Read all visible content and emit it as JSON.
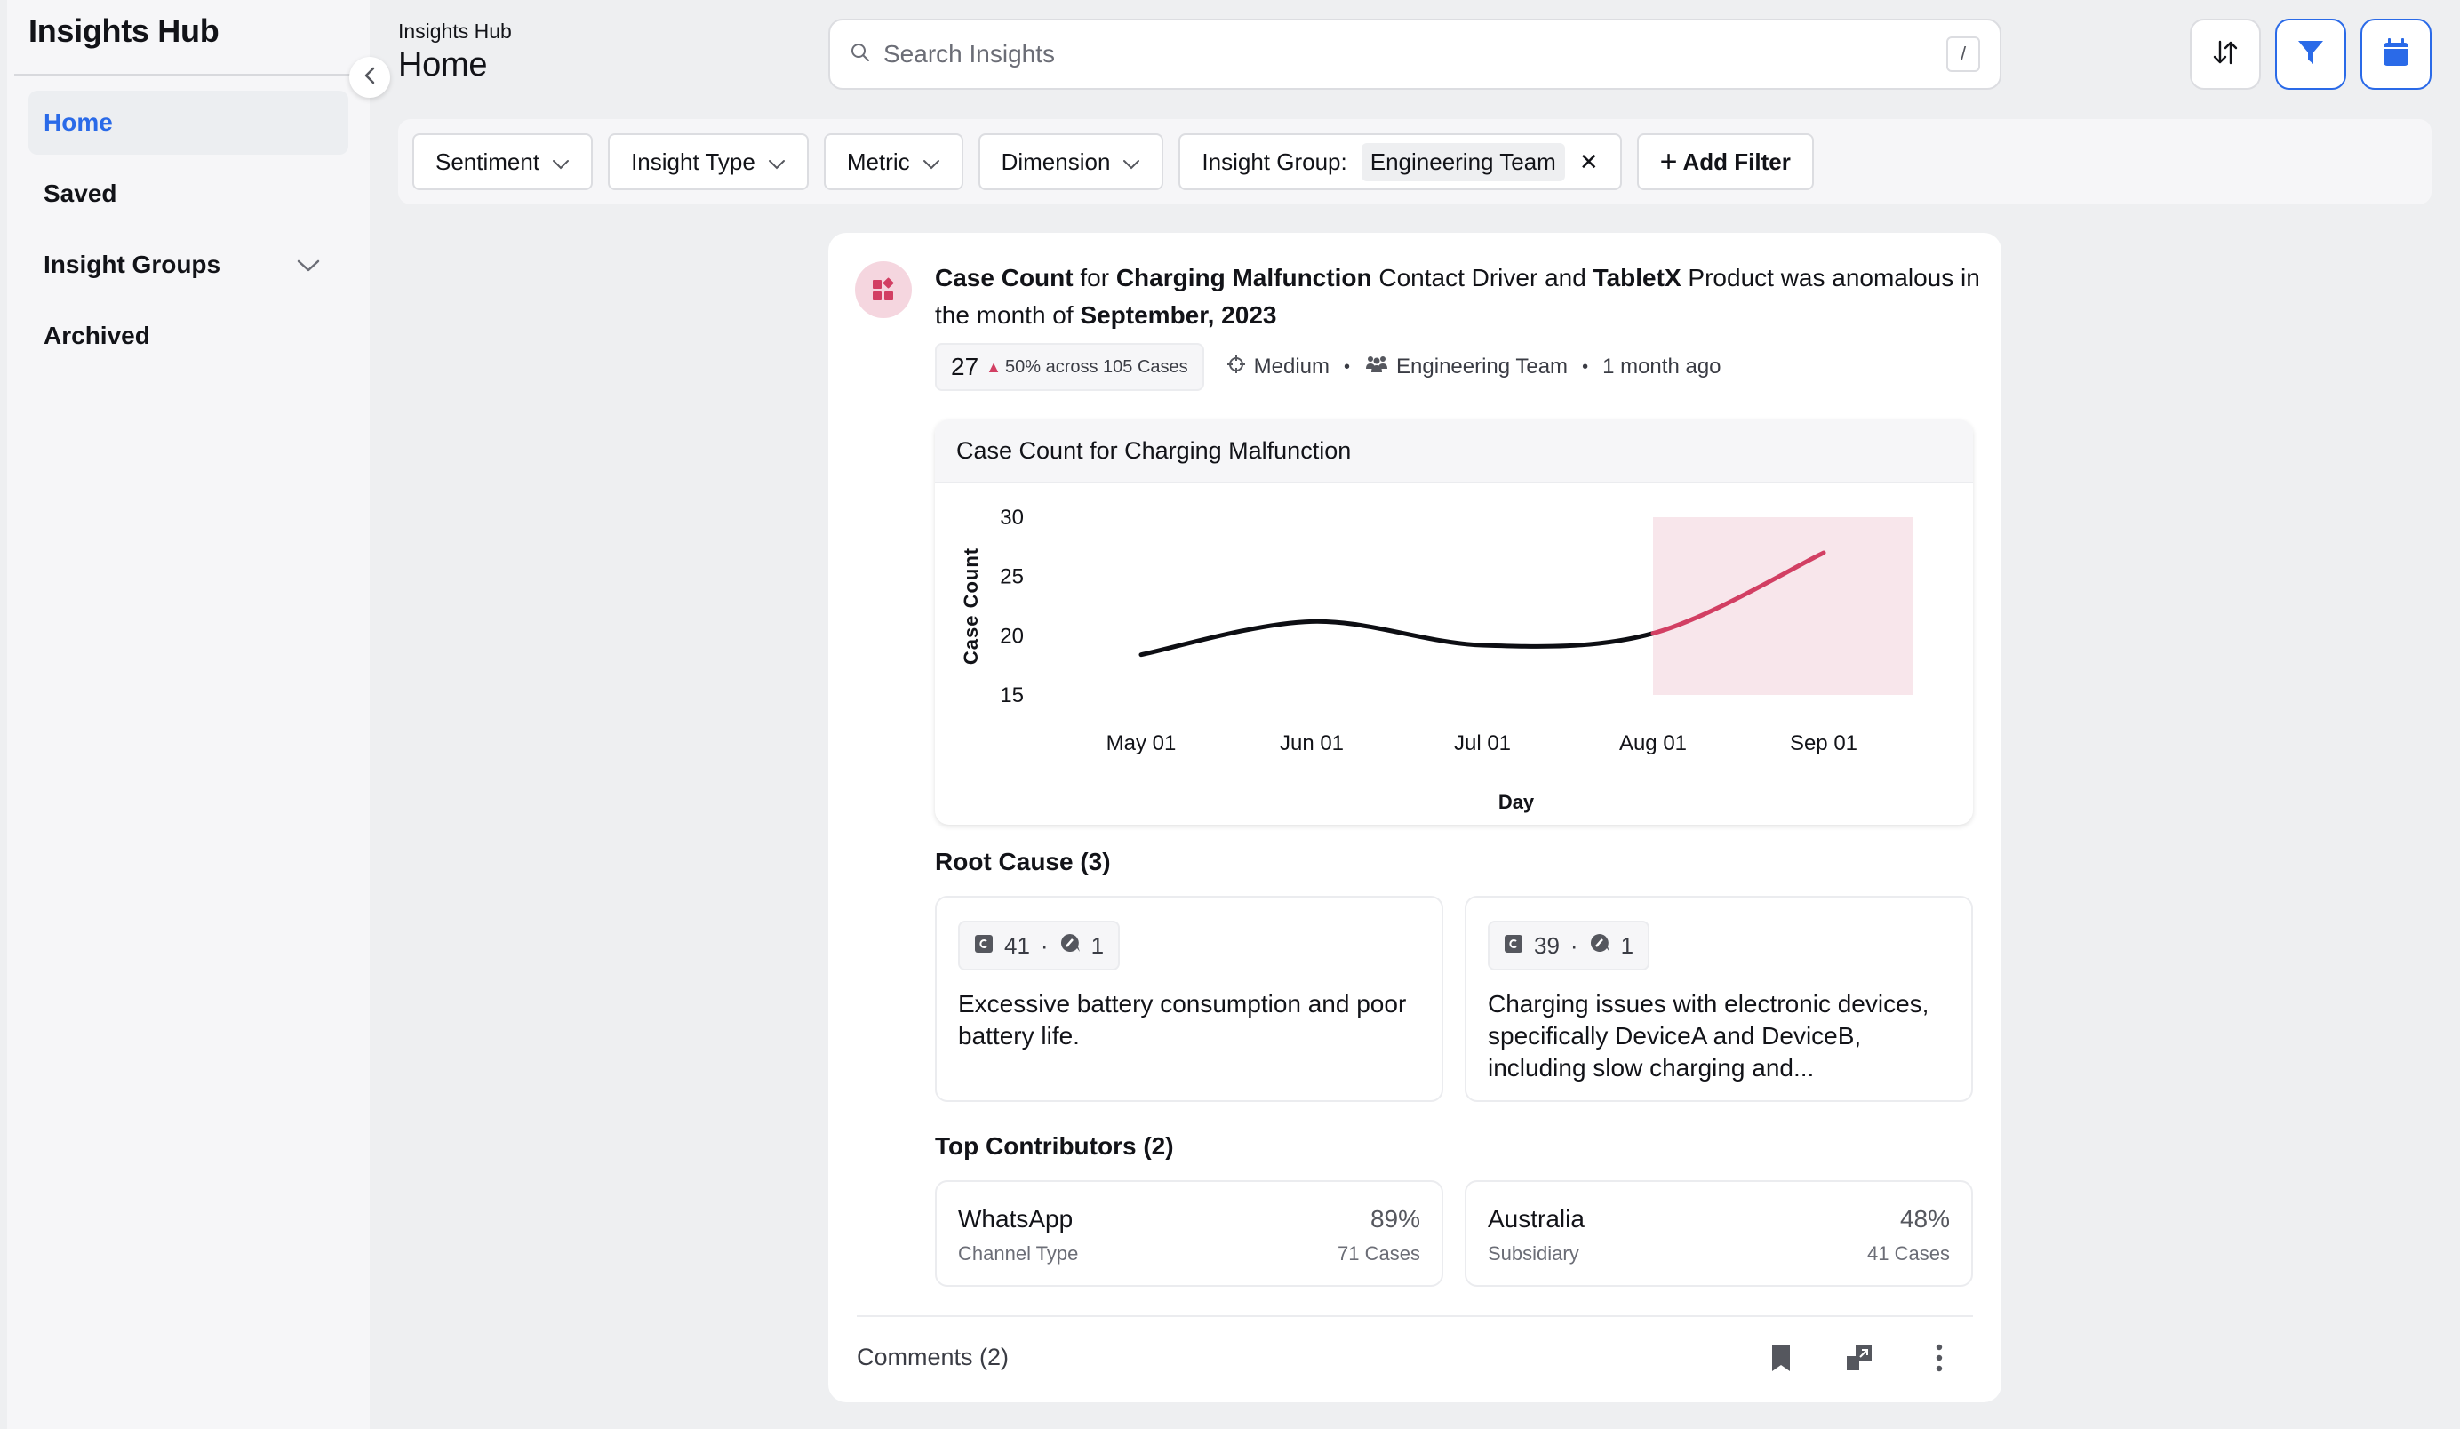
{
  "sidebar": {
    "brand": "Insights Hub",
    "items": [
      {
        "label": "Home",
        "active": true
      },
      {
        "label": "Saved"
      },
      {
        "label": "Insight Groups",
        "expandable": true
      },
      {
        "label": "Archived"
      }
    ]
  },
  "header": {
    "breadcrumb": "Insights Hub",
    "title": "Home",
    "search_placeholder": "Search Insights",
    "search_value": "",
    "search_shortcut": "/",
    "buttons": [
      "sort-icon",
      "filter-icon",
      "calendar-icon"
    ],
    "accent": "#2a6ae8"
  },
  "filters": {
    "items": [
      "Sentiment",
      "Insight Type",
      "Metric",
      "Dimension"
    ],
    "group_label": "Insight Group:",
    "group_value": "Engineering Team",
    "add_label": "Add Filter"
  },
  "insight": {
    "headline": {
      "metric": "Case Count",
      "t1": " for ",
      "driver": "Charging Malfunction",
      "t2": " Contact Driver and ",
      "product": "TabletX",
      "t3": " Product was anomalous in the month of ",
      "period": "September, 2023"
    },
    "value": "27",
    "change": "50% across 105 Cases",
    "priority": "Medium",
    "group": "Engineering Team",
    "time": "1 month ago",
    "accent": "#d23f63",
    "chart_title": "Case Count for Charging Malfunction",
    "root_cause_title": "Root Cause (3)",
    "root_causes": [
      {
        "cases": "41",
        "comments": "1",
        "text": "Excessive battery consumption and poor battery life."
      },
      {
        "cases": "39",
        "comments": "1",
        "text": "Charging issues with electronic devices, specifically DeviceA and DeviceB, including slow charging and..."
      }
    ],
    "contributors_title": "Top Contributors (2)",
    "contributors": [
      {
        "name": "WhatsApp",
        "type": "Channel Type",
        "pct": "89%",
        "cases": "71 Cases"
      },
      {
        "name": "Australia",
        "type": "Subsidiary",
        "pct": "48%",
        "cases": "41 Cases"
      }
    ],
    "comments_label": "Comments (2)"
  },
  "chart_data": {
    "type": "line",
    "title": "Case Count for Charging Malfunction",
    "xlabel": "Day",
    "ylabel": "Case Count",
    "categories": [
      "May 01",
      "Jun 01",
      "Jul 01",
      "Aug 01",
      "Sep 01"
    ],
    "series": [
      {
        "name": "Case Count",
        "values": [
          18.4,
          21.2,
          19.2,
          20.2,
          27
        ]
      }
    ],
    "anomaly_range": [
      "Aug 01",
      "Sep 01"
    ],
    "yticks": [
      15,
      20,
      25,
      30
    ],
    "ylim": [
      15,
      30
    ],
    "grid": false,
    "line_color": "#0d0e13",
    "anomaly_color": "#d23f63",
    "anomaly_fill": "#f8e6eb"
  }
}
